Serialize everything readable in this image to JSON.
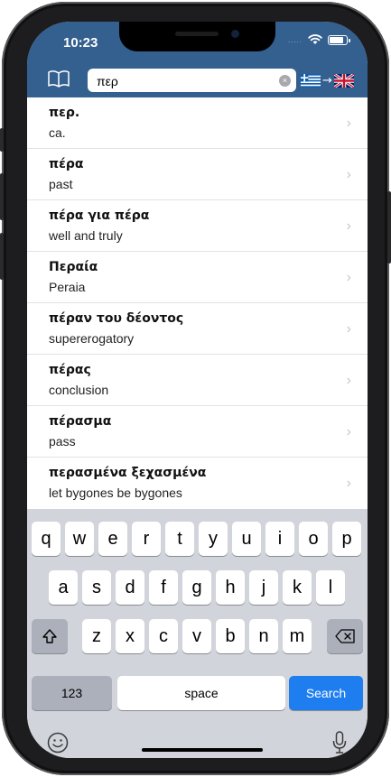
{
  "status_bar": {
    "time": "10:23",
    "signal_dots": "....."
  },
  "header": {
    "search_query": "περ",
    "clear_icon": "×",
    "book_icon": "book-icon",
    "language_pair": "greek-to-english",
    "language_arrow": "→"
  },
  "results": [
    {
      "headword": "περ.",
      "translation": "ca."
    },
    {
      "headword": "πέρα",
      "translation": "past"
    },
    {
      "headword": "πέρα για πέρα",
      "translation": "well and truly"
    },
    {
      "headword": "Περαία",
      "translation": "Peraia"
    },
    {
      "headword": "πέραν του δέοντος",
      "translation": "supererogatory"
    },
    {
      "headword": "πέρας",
      "translation": "conclusion"
    },
    {
      "headword": "πέρασμα",
      "translation": "pass"
    },
    {
      "headword": "περασμένα ξεχασμένα",
      "translation": "let bygones be bygones"
    }
  ],
  "keyboard": {
    "row1": [
      "q",
      "w",
      "e",
      "r",
      "t",
      "y",
      "u",
      "i",
      "o",
      "p"
    ],
    "row2": [
      "a",
      "s",
      "d",
      "f",
      "g",
      "h",
      "j",
      "k",
      "l"
    ],
    "row3": [
      "z",
      "x",
      "c",
      "v",
      "b",
      "n",
      "m"
    ],
    "numbers_label": "123",
    "space_label": "space",
    "search_label": "Search"
  },
  "colors": {
    "header_blue": "#34608f",
    "search_key_blue": "#1e7ef0"
  }
}
